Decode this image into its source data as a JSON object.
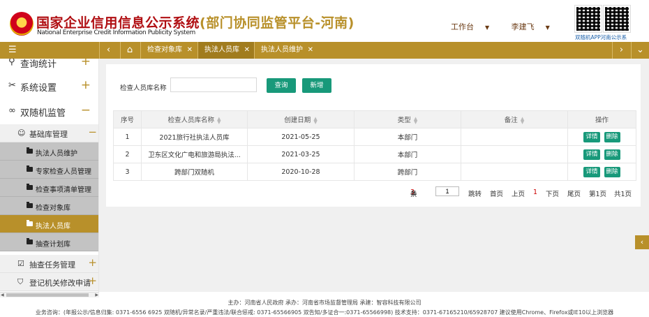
{
  "header": {
    "title_cn": "国家企业信用信息公示系统",
    "title_suffix": "(部门协同监管平台-河南)",
    "title_en": "National Enterprise Credit Information Publicity System",
    "workbench": "工作台",
    "user": "李建飞",
    "qr_caption": "双随机APP河南公示系"
  },
  "tabbar": {
    "tabs": [
      {
        "label": "检查对象库"
      },
      {
        "label": "执法人员库"
      },
      {
        "label": "执法人员维护"
      }
    ]
  },
  "sidebar": {
    "level1": [
      {
        "label": "查询统计",
        "sign": "+"
      },
      {
        "label": "系统设置",
        "sign": "+"
      },
      {
        "label": "双随机监管",
        "sign": "−"
      }
    ],
    "level2": [
      {
        "label": "基础库管理",
        "sign": "−"
      },
      {
        "label": "抽查任务管理",
        "sign": "+"
      },
      {
        "label": "登记机关修改申请",
        "sign": "+"
      }
    ],
    "level3": [
      {
        "label": "执法人员维护"
      },
      {
        "label": "专家检查人员管理"
      },
      {
        "label": "检查事项清单管理"
      },
      {
        "label": "检查对象库"
      },
      {
        "label": "执法人员库"
      },
      {
        "label": "抽查计划库"
      }
    ]
  },
  "search": {
    "label": "检查人员库名称",
    "value": "",
    "query_label": "查询",
    "add_label": "新增"
  },
  "table": {
    "columns": [
      "序号",
      "检查人员库名称",
      "创建日期",
      "类型",
      "备注",
      "操作"
    ],
    "rows": [
      {
        "no": "1",
        "name": "2021旅行社执法人员库",
        "date": "2021-05-25",
        "type": "本部门",
        "remark": ""
      },
      {
        "no": "2",
        "name": "卫东区文化广电和旅游局执法...",
        "date": "2021-03-25",
        "type": "本部门",
        "remark": ""
      },
      {
        "no": "3",
        "name": "跨部门双随机",
        "date": "2020-10-28",
        "type": "跨部门",
        "remark": ""
      }
    ],
    "detail_label": "详情",
    "delete_label": "删除"
  },
  "pager": {
    "total_prefix": "共",
    "total": "3",
    "total_suffix": "条",
    "page_value": "1",
    "jump": "跳转",
    "first": "首页",
    "prev": "上页",
    "current": "1",
    "next": "下页",
    "last": "尾页",
    "page_of": "第1页",
    "page_count": "共1页"
  },
  "footer": {
    "line1": "主办：河南省人民政府  承办：河南省市场监督管理局  承建：智容科技有限公司",
    "line2": "业务咨询：(年报公示/信息归集: 0371-6556 6925    双随机/异常名录/严重违法/联合惩戒: 0371-65566905    双告知/多证合一:0371-65566998)    技术支持：0371-67165210/65928707  建议使用Chrome、Firefox或IE10以上浏览器"
  },
  "colors": {
    "gold": "#b8902a",
    "green": "#18997a",
    "brand_red": "#b00e12"
  }
}
